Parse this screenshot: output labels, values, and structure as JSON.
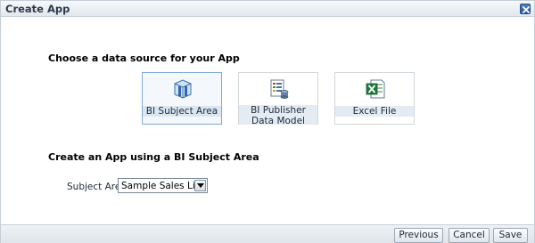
{
  "dialog": {
    "title": "Create App",
    "close_icon": "close-icon"
  },
  "sections": {
    "data_source_title": "Choose a data source for your App",
    "subject_area_title": "Create an App using a BI Subject Area"
  },
  "sources": [
    {
      "label": "BI Subject Area",
      "icon": "subject-area-cube-icon",
      "selected": true
    },
    {
      "label": "BI Publisher Data Model",
      "icon": "data-model-icon",
      "selected": false
    },
    {
      "label": "Excel File",
      "icon": "excel-file-icon",
      "selected": false
    }
  ],
  "subject_area": {
    "label": "Subject Area",
    "value": "Sample Sales Lite"
  },
  "buttons": {
    "previous": "Previous",
    "cancel": "Cancel",
    "save": "Save"
  },
  "colors": {
    "accent": "#2c5a9a",
    "selected_border": "#7fa9d4",
    "excel_green": "#1e7a3c"
  }
}
